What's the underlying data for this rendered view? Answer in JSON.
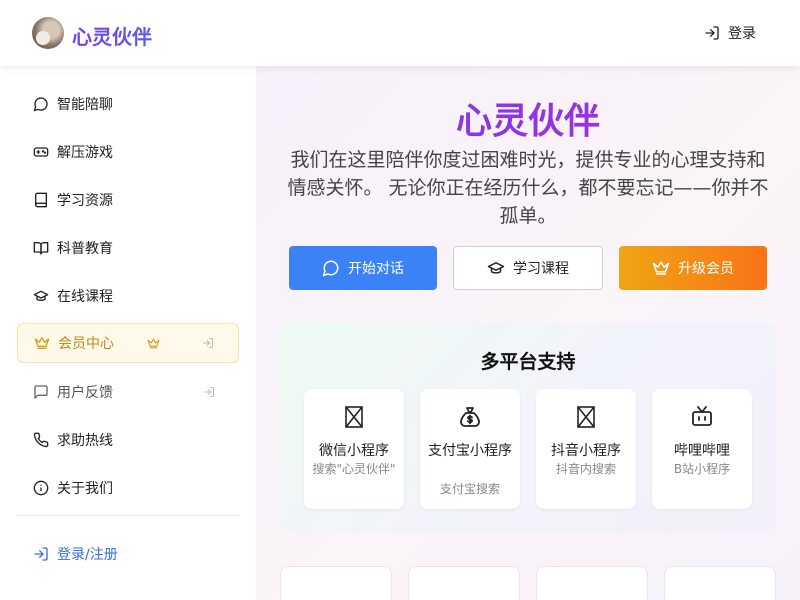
{
  "header": {
    "brand": "心灵伙伴",
    "login_label": "登录"
  },
  "sidebar": {
    "items": [
      {
        "label": "智能陪聊",
        "icon": "chat-bubble-icon"
      },
      {
        "label": "解压游戏",
        "icon": "gamepad-icon"
      },
      {
        "label": "学习资源",
        "icon": "book-icon"
      },
      {
        "label": "科普教育",
        "icon": "open-book-icon"
      },
      {
        "label": "在线课程",
        "icon": "graduation-cap-icon"
      },
      {
        "label": "会员中心",
        "icon": "crown-icon"
      },
      {
        "label": "用户反馈",
        "icon": "message-square-icon"
      },
      {
        "label": "求助热线",
        "icon": "phone-icon"
      },
      {
        "label": "关于我们",
        "icon": "info-icon"
      }
    ],
    "login_register_label": "登录/注册"
  },
  "hero": {
    "title": "心灵伙伴",
    "description": "我们在这里陪伴你度过困难时光，提供专业的心理支持和情感关怀。 无论你正在经历什么，都不要忘记——你并不孤单。"
  },
  "buttons": {
    "chat": "开始对话",
    "course": "学习课程",
    "vip": "升级会员"
  },
  "platforms": {
    "title": "多平台支持",
    "cards": [
      {
        "name": "微信小程序",
        "sub": "搜索\"心灵伙伴\"",
        "icon": "image-placeholder-icon"
      },
      {
        "name": "支付宝小程序",
        "sub": "支付宝搜索",
        "icon": "money-bag-icon"
      },
      {
        "name": "抖音小程序",
        "sub": "抖音内搜索",
        "icon": "image-placeholder-icon"
      },
      {
        "name": "哔哩哔哩",
        "sub": "B站小程序",
        "icon": "tv-icon"
      }
    ]
  },
  "colors": {
    "brand_purple": "#7c3aed",
    "primary_blue": "#3b82f6",
    "vip_orange": "#f97316",
    "member_gold": "#d99a1a"
  }
}
